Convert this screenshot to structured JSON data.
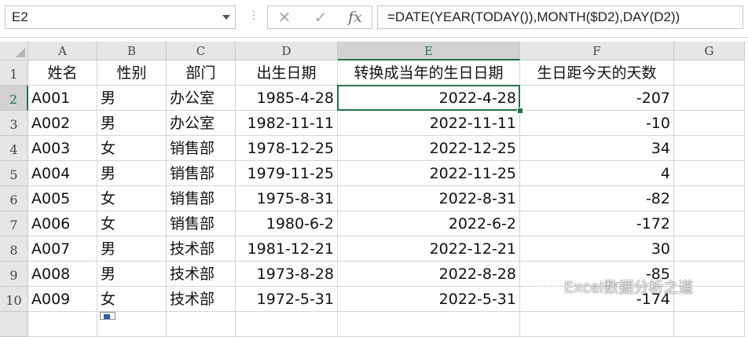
{
  "formula_bar": {
    "name_box": "E2",
    "cancel_glyph": "✕",
    "enter_glyph": "✓",
    "fx_label": "fx",
    "formula": "=DATE(YEAR(TODAY()),MONTH($D2),DAY(D2))"
  },
  "columns": [
    "A",
    "B",
    "C",
    "D",
    "E",
    "F",
    "G"
  ],
  "rows": [
    "1",
    "2",
    "3",
    "4",
    "5",
    "6",
    "7",
    "8",
    "9",
    "10"
  ],
  "headers": [
    "姓名",
    "性别",
    "部门",
    "出生日期",
    "转换成当年的生日日期",
    "生日距今天的天数"
  ],
  "data": [
    [
      "A001",
      "男",
      "办公室",
      "1985-4-28",
      "2022-4-28",
      "-207"
    ],
    [
      "A002",
      "男",
      "办公室",
      "1982-11-11",
      "2022-11-11",
      "-10"
    ],
    [
      "A003",
      "女",
      "销售部",
      "1978-12-25",
      "2022-12-25",
      "34"
    ],
    [
      "A004",
      "男",
      "销售部",
      "1979-11-25",
      "2022-11-25",
      "4"
    ],
    [
      "A005",
      "女",
      "销售部",
      "1975-8-31",
      "2022-8-31",
      "-82"
    ],
    [
      "A006",
      "女",
      "销售部",
      "1980-6-2",
      "2022-6-2",
      "-172"
    ],
    [
      "A007",
      "男",
      "技术部",
      "1981-12-21",
      "2022-12-21",
      "30"
    ],
    [
      "A008",
      "男",
      "技术部",
      "1973-8-28",
      "2022-8-28",
      "-85"
    ],
    [
      "A009",
      "女",
      "技术部",
      "1972-5-31",
      "2022-5-31",
      "-174"
    ]
  ],
  "selected_cell": "E2",
  "watermark": "Excel数据分析之道",
  "colors": {
    "accent": "#217346",
    "header_bg": "#e6e6e6",
    "gridline": "#d4d4d4"
  }
}
